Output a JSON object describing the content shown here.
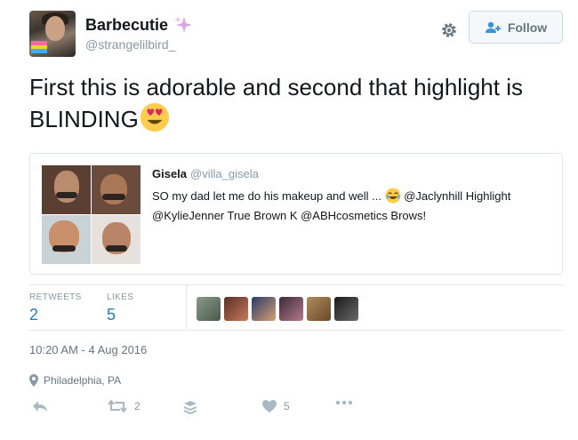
{
  "author": {
    "name": "Barbecutie",
    "handle": "@strangelilbird_"
  },
  "follow_label": "Follow",
  "tweet": {
    "text": "First this is adorable and second that highlight is BLINDING"
  },
  "quoted": {
    "name": "Gisela",
    "handle": "@villa_gisela",
    "text_part1": "SO my dad let me do his makeup and well ...",
    "text_part2": "@Jaclynhill Highlight @KylieJenner True Brown K @ABHcosmetics Brows!"
  },
  "stats": {
    "retweets_label": "RETWEETS",
    "retweets": "2",
    "likes_label": "LIKES",
    "likes": "5"
  },
  "likers_count": 6,
  "timestamp": "10:20 AM - 4 Aug 2016",
  "location": "Philadelphia, PA",
  "actions": {
    "retweet_count": "2",
    "like_count": "5"
  },
  "icons": [
    "sparkles-icon",
    "gear-icon",
    "add-user-icon",
    "heart-eyes-emoji",
    "joy-emoji",
    "location-pin-icon",
    "reply-icon",
    "retweet-icon",
    "buffer-icon",
    "like-icon",
    "more-icon"
  ],
  "colors": {
    "link": "#2b7bb9",
    "muted": "#8899a6",
    "border": "#e1e8ed"
  }
}
